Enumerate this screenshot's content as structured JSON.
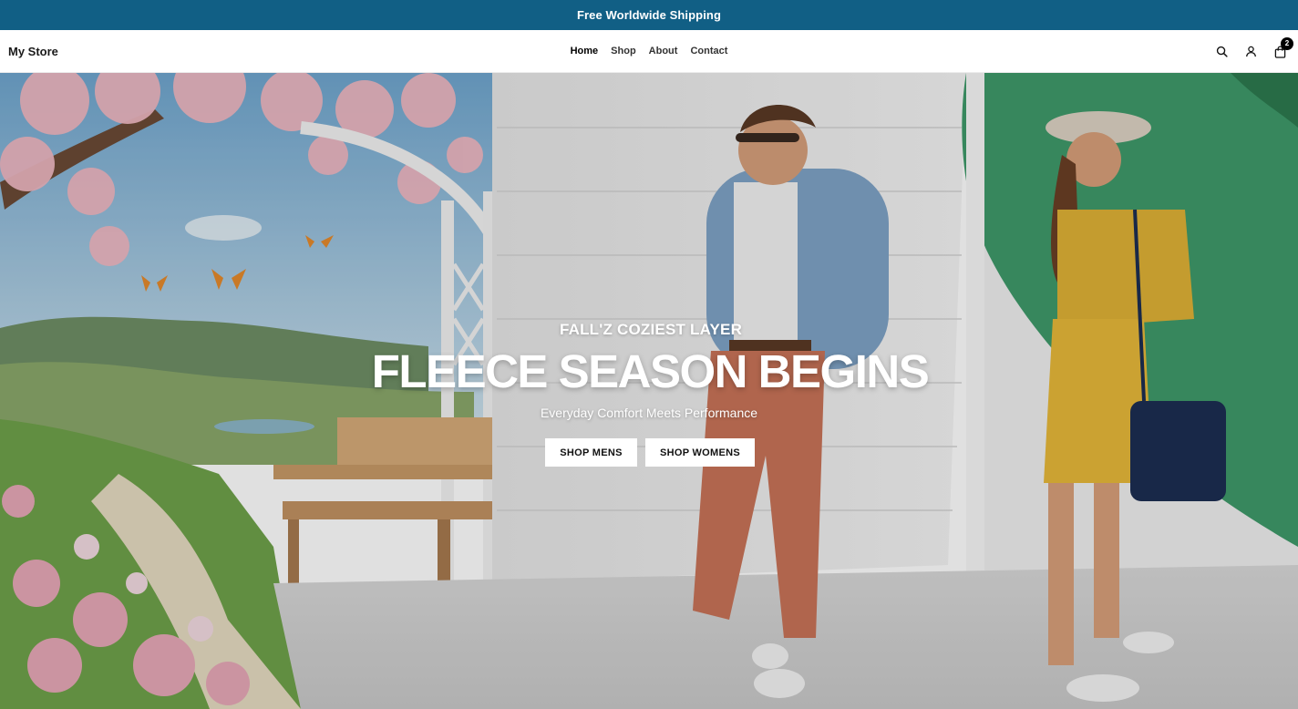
{
  "announcement": {
    "text": "Free Worldwide Shipping"
  },
  "header": {
    "logo": "My Store",
    "nav": [
      {
        "label": "Home",
        "active": true
      },
      {
        "label": "Shop",
        "active": false
      },
      {
        "label": "About",
        "active": false
      },
      {
        "label": "Contact",
        "active": false
      }
    ],
    "icons": [
      "search-icon",
      "account-icon",
      "cart-icon"
    ],
    "cart_count": "2"
  },
  "hero": {
    "eyebrow": "FALL'Z COZIEST LAYER",
    "headline": "FLEECE SEASON BEGINS",
    "subhead": "Everyday Comfort Meets Performance",
    "buttons": {
      "mens": "SHOP MENS",
      "womens": "SHOP WOMENS"
    }
  },
  "colors": {
    "announcement_bg": "#115f85",
    "accent_green": "#3f9a6a",
    "button_bg": "#ffffff"
  }
}
